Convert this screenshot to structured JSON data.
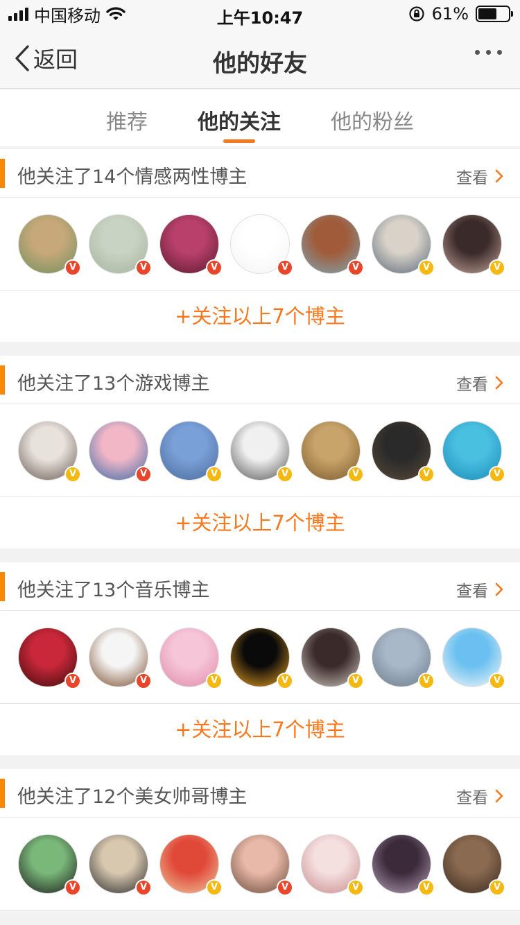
{
  "status_bar": {
    "carrier": "中国移动",
    "time": "上午10:47",
    "battery": "61%",
    "battery_level": 0.61
  },
  "nav": {
    "back_label": "返回",
    "title": "他的好友"
  },
  "tabs": [
    {
      "label": "推荐"
    },
    {
      "label": "他的关注"
    },
    {
      "label": "他的粉丝"
    }
  ],
  "sections": [
    {
      "title": "他关注了14个情感两性博主",
      "view_label": "查看",
      "follow_label": "+关注以上7个博主",
      "avatars": [
        {
          "badge": "red",
          "colors": [
            "#c7a87a",
            "#6f8f5e"
          ]
        },
        {
          "badge": "red",
          "colors": [
            "#c9d3c3",
            "#a5b3a0"
          ]
        },
        {
          "badge": "red",
          "colors": [
            "#b8406a",
            "#5a1a2f"
          ]
        },
        {
          "badge": "red",
          "colors": [
            "#ffffff",
            "#f3f3f3"
          ]
        },
        {
          "badge": "red",
          "colors": [
            "#a05c3a",
            "#7fa7b8"
          ]
        },
        {
          "badge": "yellow",
          "colors": [
            "#d8d2c8",
            "#5a6a7a"
          ]
        },
        {
          "badge": "yellow",
          "colors": [
            "#3a2a2a",
            "#c7a59a"
          ]
        }
      ]
    },
    {
      "title": "他关注了13个游戏博主",
      "view_label": "查看",
      "follow_label": "+关注以上7个博主",
      "avatars": [
        {
          "badge": "yellow",
          "colors": [
            "#e8e2dc",
            "#6a5a52"
          ]
        },
        {
          "badge": "red",
          "colors": [
            "#f2b7c6",
            "#3a6aa8"
          ]
        },
        {
          "badge": "yellow",
          "colors": [
            "#7aa0d8",
            "#4a6a9a"
          ]
        },
        {
          "badge": "yellow",
          "colors": [
            "#f0f0f0",
            "#555555"
          ]
        },
        {
          "badge": "yellow",
          "colors": [
            "#c8a46a",
            "#7a5a2a"
          ]
        },
        {
          "badge": "yellow",
          "colors": [
            "#2a2a2a",
            "#5a4a3a"
          ]
        },
        {
          "badge": "yellow",
          "colors": [
            "#4ac0e0",
            "#1a8ab8"
          ]
        }
      ]
    },
    {
      "title": "他关注了13个音乐博主",
      "view_label": "查看",
      "follow_label": "+关注以上7个博主",
      "avatars": [
        {
          "badge": "red",
          "colors": [
            "#c8283a",
            "#3a0a0a"
          ]
        },
        {
          "badge": "red",
          "colors": [
            "#f5f5f5",
            "#7a4a2a"
          ]
        },
        {
          "badge": "yellow",
          "colors": [
            "#f6c6d8",
            "#e08aa8"
          ]
        },
        {
          "badge": "yellow",
          "colors": [
            "#0a0a0a",
            "#e8a020"
          ]
        },
        {
          "badge": "yellow",
          "colors": [
            "#3a2a2a",
            "#d0c8c0"
          ]
        },
        {
          "badge": "yellow",
          "colors": [
            "#a8b8c8",
            "#6a7a88"
          ]
        },
        {
          "badge": "yellow",
          "colors": [
            "#6ac0f0",
            "#f8f8f8"
          ]
        }
      ]
    },
    {
      "title": "他关注了12个美女帅哥博主",
      "view_label": "查看",
      "follow_label": "",
      "avatars": [
        {
          "badge": "red",
          "colors": [
            "#7ab87a",
            "#1a1a1a"
          ]
        },
        {
          "badge": "red",
          "colors": [
            "#d8c8b0",
            "#2a2a2a"
          ]
        },
        {
          "badge": "yellow",
          "colors": [
            "#e04838",
            "#f0c8a0"
          ]
        },
        {
          "badge": "red",
          "colors": [
            "#e8b8a8",
            "#6a4a3a"
          ]
        },
        {
          "badge": "yellow",
          "colors": [
            "#f5e0e0",
            "#c88a8a"
          ]
        },
        {
          "badge": "yellow",
          "colors": [
            "#3a2a3a",
            "#b8a0b8"
          ]
        },
        {
          "badge": "yellow",
          "colors": [
            "#8a6a50",
            "#3a2a20"
          ]
        }
      ]
    }
  ],
  "colors": {
    "accent": "#f7781e",
    "section_marker": "#fa8700",
    "badge_red": "#e8452a",
    "badge_yellow": "#f5b80f"
  }
}
